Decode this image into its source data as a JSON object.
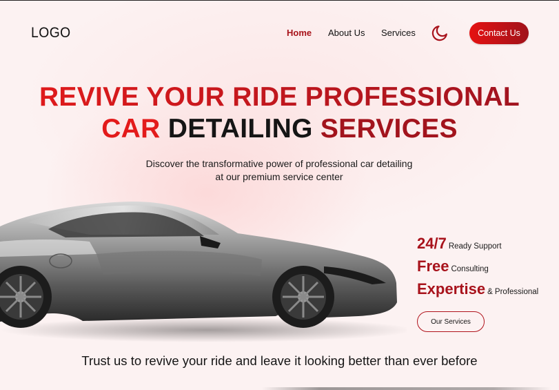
{
  "header": {
    "logo": "LOGO",
    "nav": [
      {
        "label": "Home",
        "active": true
      },
      {
        "label": "About Us",
        "active": false
      },
      {
        "label": "Services",
        "active": false
      }
    ],
    "theme_toggle_icon": "moon-icon",
    "contact_label": "Contact Us"
  },
  "hero": {
    "headline_line1": "REVIVE YOUR RIDE PROFESSIONAL",
    "headline_line2_word1": "CAR",
    "headline_line2_word2": "DETAILING",
    "headline_line2_word3": "SERVICES",
    "subtitle": "Discover the transformative power of professional car detailing at our premium service center"
  },
  "stats": [
    {
      "big": "24/7",
      "small": "Ready Support"
    },
    {
      "big": "Free",
      "small": "Consulting"
    },
    {
      "big": "Expertise",
      "small": "& Professional"
    }
  ],
  "services_button_label": "Our Services",
  "tagline": "Trust us to revive your ride and leave it looking better than ever before",
  "colors": {
    "accent_red": "#e31b1b",
    "accent_dark_red": "#a2141d",
    "background": "#fcf2f2"
  }
}
